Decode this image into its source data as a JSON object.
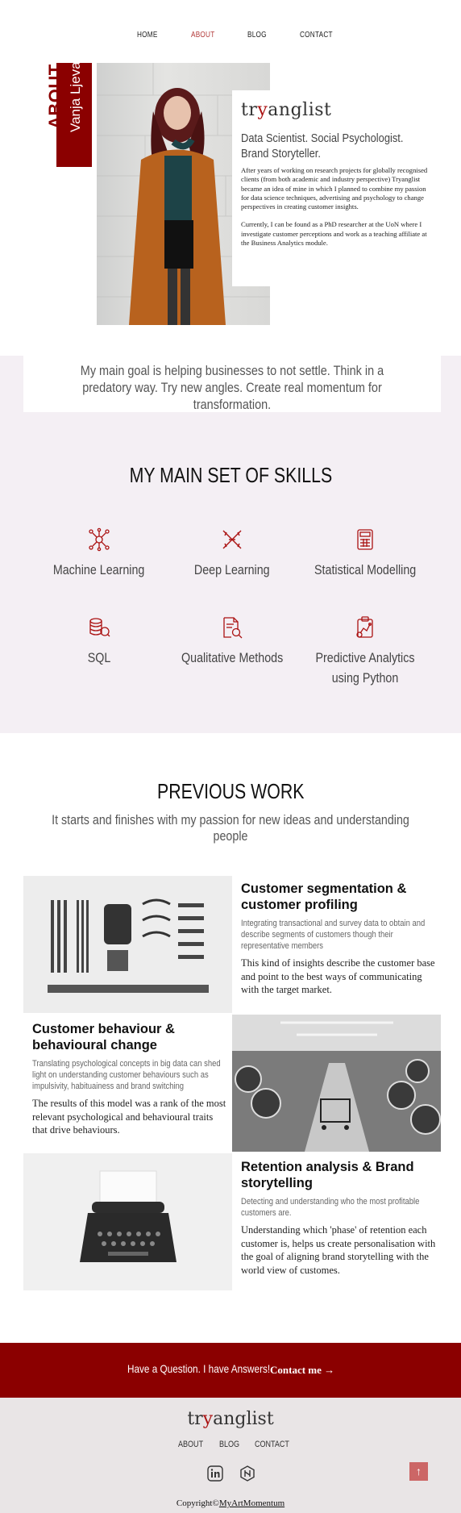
{
  "nav": {
    "items": [
      {
        "label": "HOME",
        "active": false
      },
      {
        "label": "ABOUT",
        "active": true
      },
      {
        "label": "BLOG",
        "active": false
      },
      {
        "label": "CONTACT",
        "active": false
      }
    ]
  },
  "hero": {
    "tab_heading": "ABOUT",
    "tab_name": "Vanja Ljevar",
    "brand_prefix": "tr",
    "brand_mark": "y",
    "brand_suffix": "anglist",
    "headline": "Data Scientist. Social Psychologist. Brand Storyteller.",
    "para1": "After years of working on research projects for globally recognised clients (from both academic and industry perspective) Tryanglist became an idea of mine in which I planned to combine my passion for data science techniques, advertising and psychology to change perspectives in creating customer insights.",
    "para2": "Currently, I can be found as a PhD researcher at the UoN where I investigate customer perceptions and work as a teaching affiliate at the Business Analytics module."
  },
  "goal": {
    "text": "My main goal is helping businesses to not settle. Think in a predatory way. Try new angles. Create real momentum for transformation."
  },
  "skills": {
    "title": "MY MAIN SET OF SKILLS",
    "items": [
      {
        "label": "Machine Learning",
        "icon": "neural-network-icon"
      },
      {
        "label": "Deep Learning",
        "icon": "dna-icon"
      },
      {
        "label": "Statistical Modelling",
        "icon": "calculator-icon"
      },
      {
        "label": "SQL",
        "icon": "database-icon"
      },
      {
        "label": "Qualitative Methods",
        "icon": "document-search-icon"
      },
      {
        "label": "Predictive Analytics using Python",
        "icon": "clipboard-chart-icon"
      }
    ]
  },
  "work": {
    "title": "PREVIOUS WORK",
    "subtitle": "It starts and finishes with my passion for new ideas and understanding people",
    "items": [
      {
        "title": "Customer segmentation & customer profiling",
        "summary": "Integrating transactional and survey data to obtain and describe segments of customers though their representative members",
        "detail": "This kind of insights describe the customer base and point to the best ways of communicating with the target market."
      },
      {
        "title": "Customer behaviour & behavioural change",
        "summary": "Translating psychological concepts in big data can shed light on understanding customer behaviours such as impulsivity, habituainess and brand switching",
        "detail": "The results of this model was a rank of the most relevant psychological and behavioural traits that drive behaviours."
      },
      {
        "title": "Retention analysis & Brand storytelling",
        "summary": "Detecting and understanding who the most profitable customers are.",
        "detail": "Understanding which 'phase' of retention each customer is, helps us create personalisation with the goal of aligning brand storytelling with the world view of customes."
      }
    ]
  },
  "cta": {
    "question": "Have a Question. I have Answers!",
    "button": "Contact me →"
  },
  "footer": {
    "nav": [
      "ABOUT",
      "BLOG",
      "CONTACT"
    ],
    "social": [
      "linkedin-icon",
      "github-icon"
    ],
    "copyright_prefix": "Copyright©",
    "copyright_link": "MyArtMomentum",
    "totop": "↑"
  },
  "colors": {
    "accent": "#8b0000",
    "link_active": "#b33a3a",
    "section_bg": "#f4eff4",
    "footer_bg": "#e9e5e6"
  }
}
